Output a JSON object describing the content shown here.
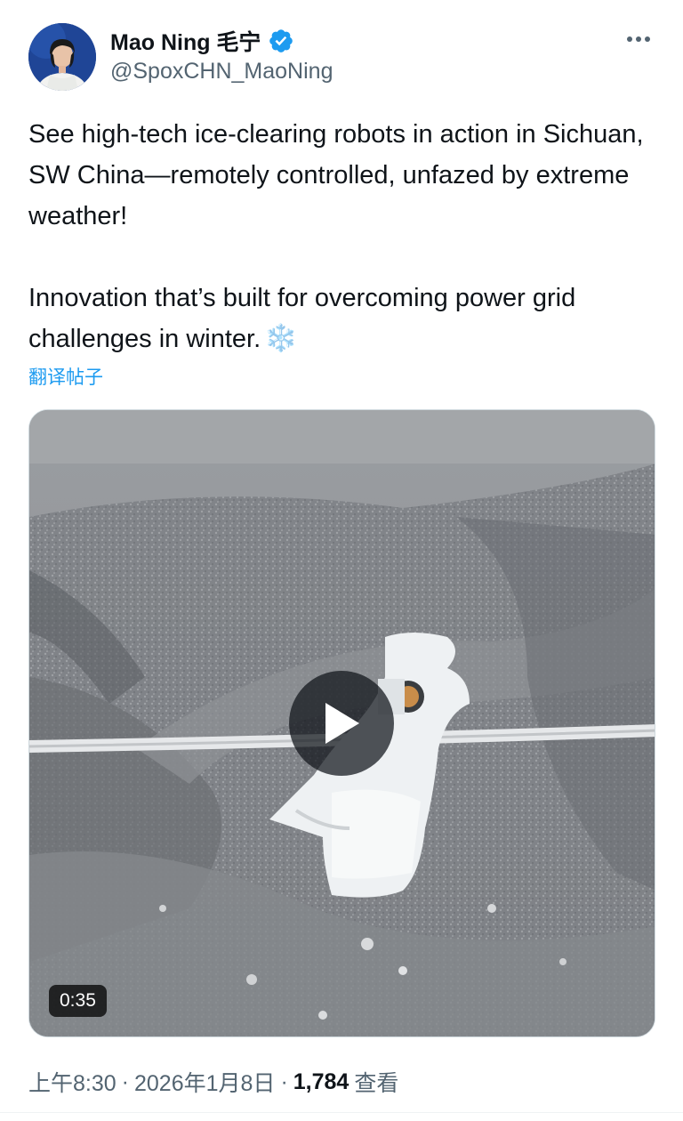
{
  "author": {
    "display_name": "Mao Ning 毛宁",
    "handle": "@SpoxCHN_MaoNing",
    "verified_color": "#1d9bf0"
  },
  "post": {
    "paragraph1": "See high-tech ice-clearing robots in action in Sichuan, SW China—remotely controlled, unfazed by extreme weather!",
    "paragraph2": "Innovation that’s built for overcoming power grid challenges in winter.",
    "emoji": "❄️",
    "translate_label": "翻译帖子"
  },
  "media": {
    "duration": "0:35",
    "play_icon": "play-icon"
  },
  "meta": {
    "time": "上午8:30",
    "separator": "·",
    "date": "2026年1月8日",
    "views": "1,784",
    "views_label": "查看"
  },
  "icons": {
    "more": "more-horizontal-icon",
    "verified": "verified-badge-icon"
  }
}
